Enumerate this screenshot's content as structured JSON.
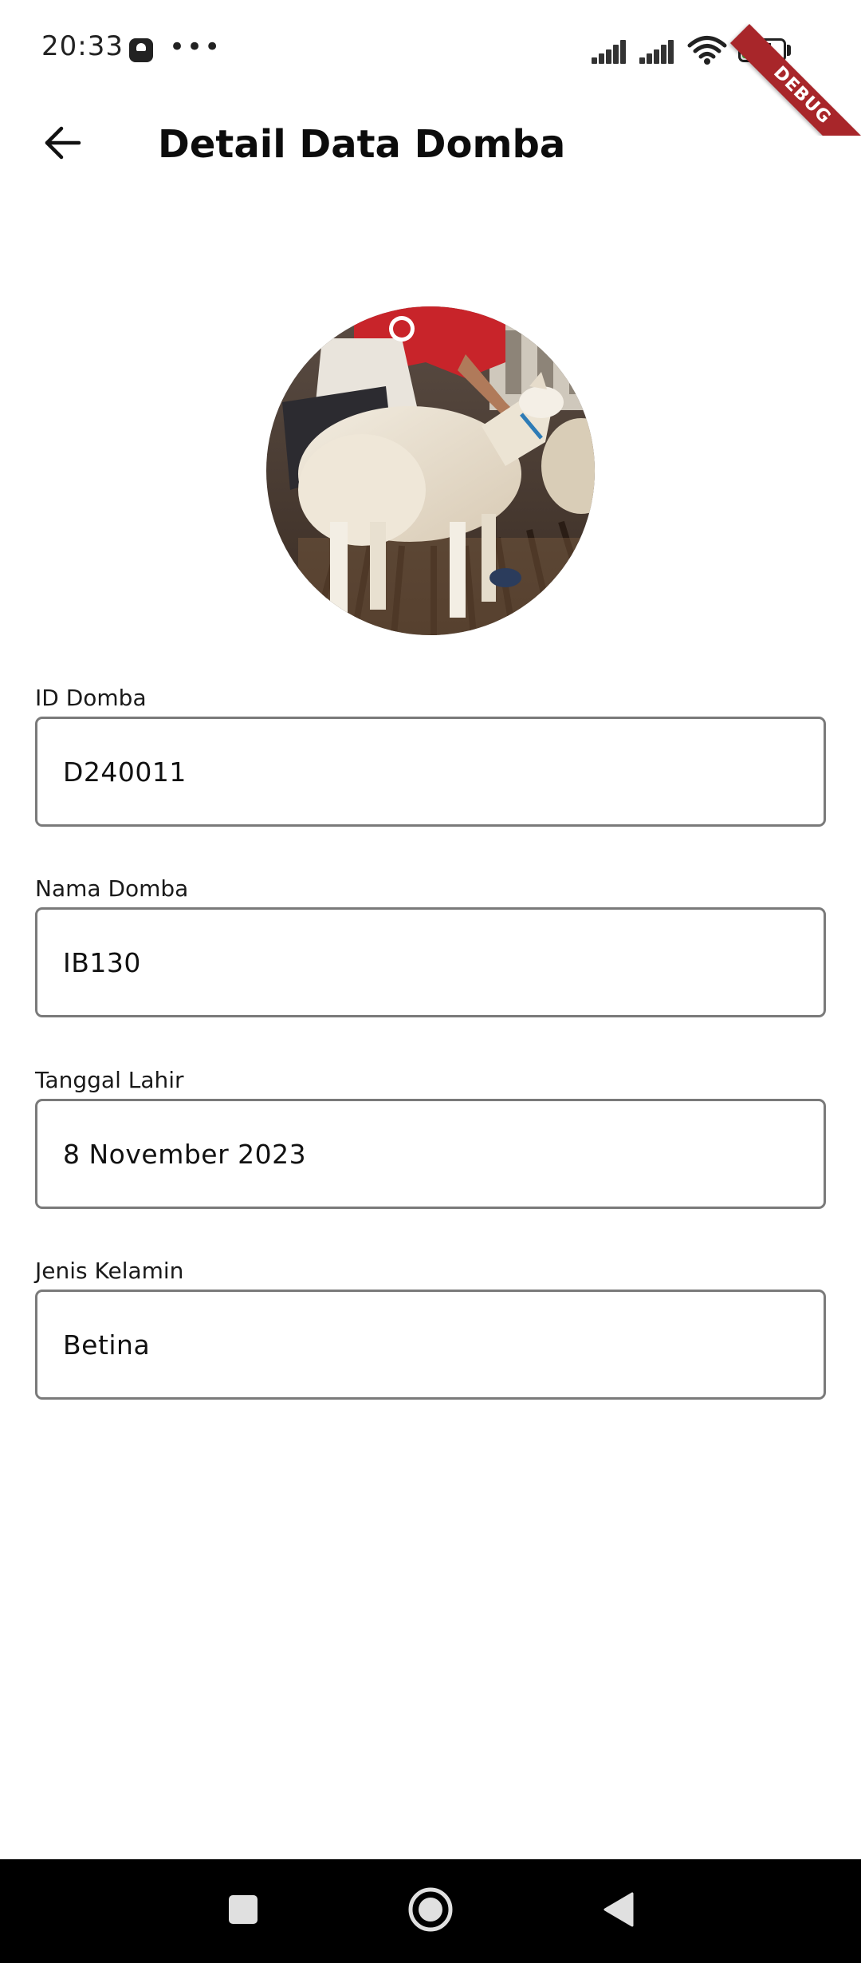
{
  "status_bar": {
    "time": "20:33",
    "more": "•••",
    "battery_level": 54,
    "battery_text": "54"
  },
  "debug_banner": "DEBUG",
  "app_bar": {
    "back_icon": "arrow-left-icon",
    "title": "Detail Data Domba"
  },
  "avatar": {
    "description_icon": "sheep-photo"
  },
  "fields": [
    {
      "label": "ID Domba",
      "value": "D240011"
    },
    {
      "label": "Nama Domba",
      "value": "IB130"
    },
    {
      "label": "Tanggal Lahir",
      "value": "8 November 2023"
    },
    {
      "label": "Jenis Kelamin",
      "value": "Betina"
    }
  ],
  "nav_bar": {
    "recent_icon": "square-icon",
    "home_icon": "circle-home-icon",
    "back_icon": "triangle-back-icon"
  },
  "colors": {
    "field_border": "#7a7a7a",
    "battery_fill": "#3cc43a",
    "debug_ribbon": "#a8262a",
    "nav_bar": "#000000"
  }
}
